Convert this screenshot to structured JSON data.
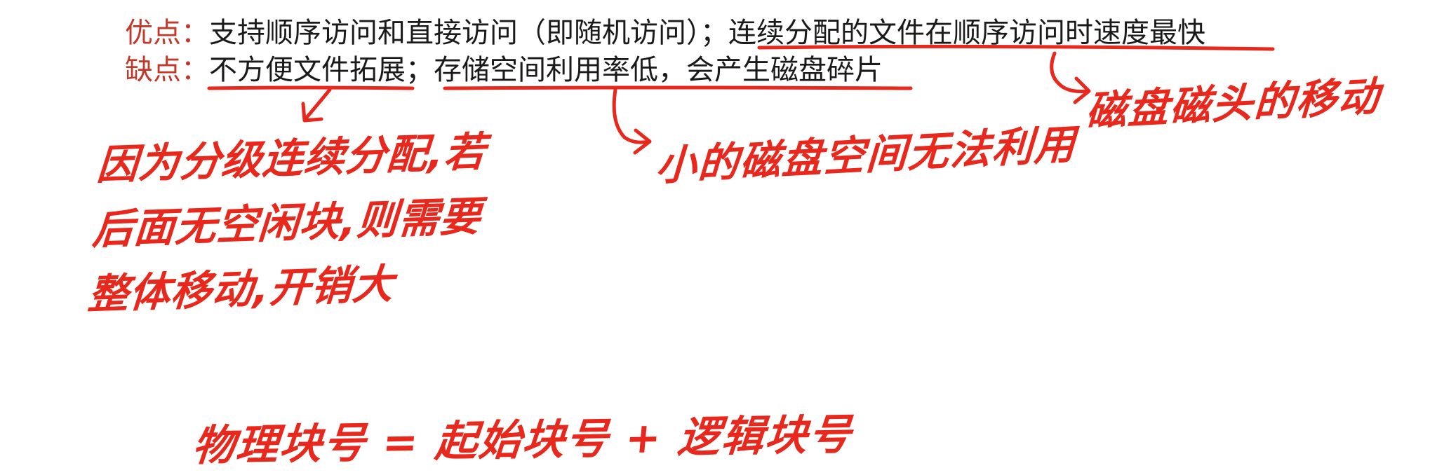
{
  "printed": {
    "pros": {
      "label": "优点：",
      "text_before": "支持顺序访问和直接访问（即随机访问）；",
      "text_underlined": "连续分配的文件在顺序访问时速度最快"
    },
    "cons": {
      "label": "缺点：",
      "text_underlined_1": "不方便文件拓展",
      "separator": "；",
      "text_underlined_2": "存储空间利用率低，会产生磁盘碎片"
    }
  },
  "handwritten": {
    "disk_head_note": "磁盘磁头的移动",
    "small_space_note": "小的磁盘空间无法利用",
    "contiguous_move_note": {
      "line1": "因为分级连续分配,若",
      "line2": "后面无空闲块,则需要",
      "line3": "整体移动,开销大"
    },
    "formula": "物理块号 = 起始块号 + 逻辑块号"
  },
  "colors": {
    "label": "#c0392b",
    "ink": "#e8281c",
    "text": "#1a1a1a"
  }
}
